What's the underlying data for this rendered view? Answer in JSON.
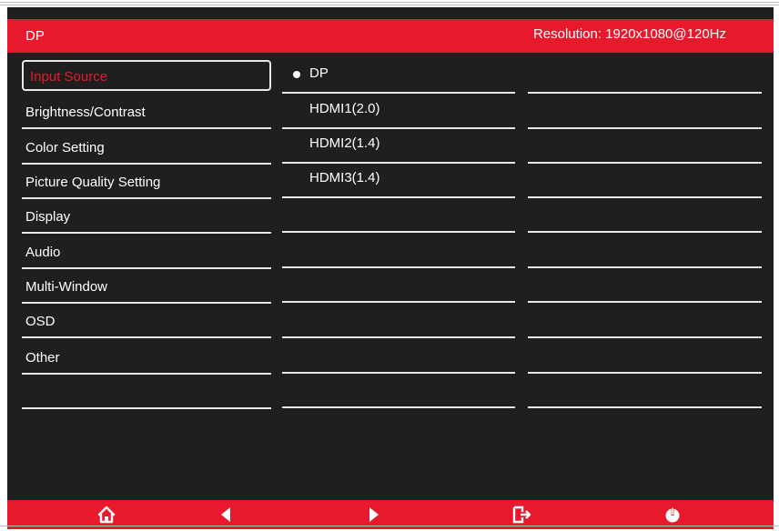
{
  "header": {
    "source": "DP",
    "resolution": "Resolution: 1920x1080@120Hz"
  },
  "menu": [
    {
      "label": "Input Source",
      "selected": true
    },
    {
      "label": "Brightness/Contrast"
    },
    {
      "label": "Color Setting"
    },
    {
      "label": "Picture Quality Setting"
    },
    {
      "label": "Display"
    },
    {
      "label": "Audio"
    },
    {
      "label": "Multi-Window"
    },
    {
      "label": "OSD"
    },
    {
      "label": "Other"
    },
    {
      "label": ""
    }
  ],
  "options": [
    {
      "label": "DP",
      "selected": true
    },
    {
      "label": "HDMI1(2.0)"
    },
    {
      "label": "HDMI2(1.4)"
    },
    {
      "label": "HDMI3(1.4)"
    }
  ],
  "footer": {
    "icons": [
      "home-icon",
      "left-arrow-icon",
      "right-arrow-icon",
      "exit-icon",
      "power-icon"
    ]
  },
  "colors": {
    "accent": "#e8192c",
    "background": "#1f1f1f",
    "text": "#ffffff"
  }
}
